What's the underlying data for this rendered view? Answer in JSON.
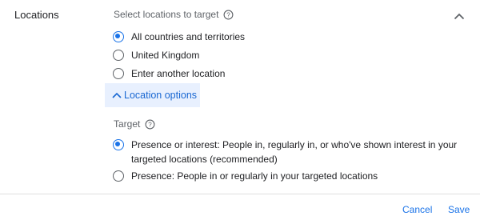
{
  "section": {
    "title": "Locations"
  },
  "target_locations": {
    "heading": "Select locations to target",
    "help_icon": "help-circle-icon",
    "options": [
      {
        "label": "All countries and territories",
        "checked": true
      },
      {
        "label": "United Kingdom",
        "checked": false
      },
      {
        "label": "Enter another location",
        "checked": false
      }
    ]
  },
  "location_options": {
    "label": "Location options",
    "icon": "chevron-up-icon"
  },
  "target": {
    "heading": "Target",
    "help_icon": "help-circle-icon",
    "options": [
      {
        "line1": "Presence or interest: People in, regularly in, or who've shown interest in your",
        "line2": "targeted locations (recommended)",
        "checked": true
      },
      {
        "line1": "Presence: People in or regularly in your targeted locations",
        "checked": false
      }
    ]
  },
  "footer": {
    "cancel_label": "Cancel",
    "save_label": "Save"
  },
  "colors": {
    "accent": "#1a73e8",
    "options_bg": "#e8f0fe"
  }
}
